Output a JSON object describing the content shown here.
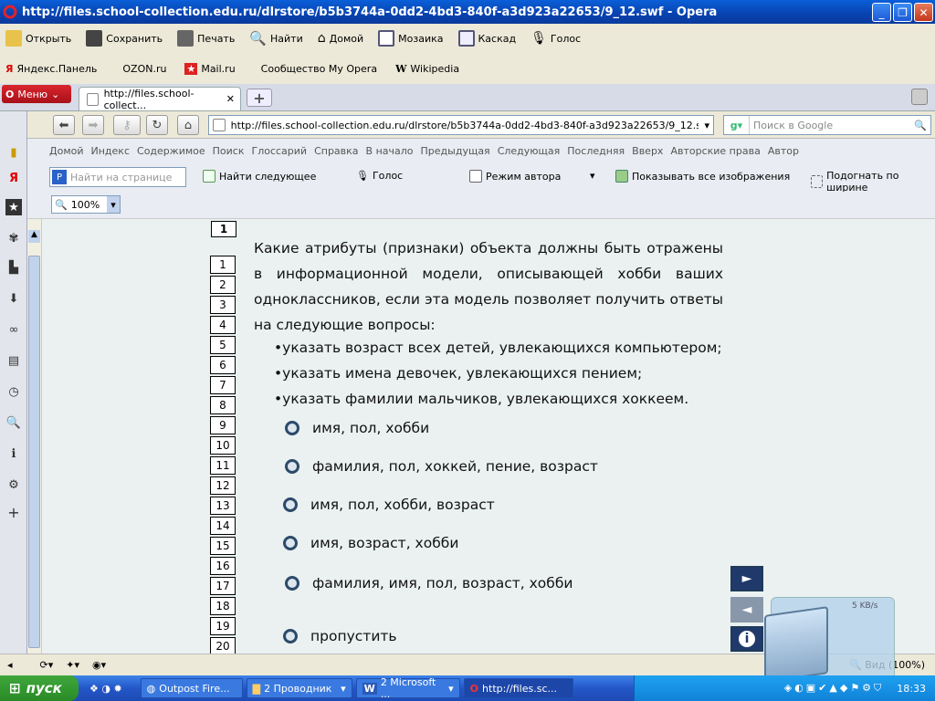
{
  "window": {
    "title": "http://files.school-collection.edu.ru/dlrstore/b5b3744a-0dd2-4bd3-840f-a3d923a22653/9_12.swf - Opera"
  },
  "toolbar_main": [
    {
      "label": "Открыть",
      "icon": "folder-open-icon"
    },
    {
      "label": "Сохранить",
      "icon": "save-icon"
    },
    {
      "label": "Печать",
      "icon": "printer-icon"
    },
    {
      "label": "Найти",
      "icon": "search-icon"
    },
    {
      "label": "Домой",
      "icon": "home-icon"
    },
    {
      "label": "Мозаика",
      "icon": "tile-icon"
    },
    {
      "label": "Каскад",
      "icon": "cascade-icon"
    },
    {
      "label": "Голос",
      "icon": "microphone-icon"
    }
  ],
  "bookmarks": [
    {
      "label": "Яндекс.Панель"
    },
    {
      "label": "OZON.ru"
    },
    {
      "label": "Mail.ru"
    },
    {
      "label": "Сообщество My Opera"
    },
    {
      "label": "Wikipedia"
    }
  ],
  "menu_button": "Меню",
  "tab": {
    "title": "http://files.school-collect..."
  },
  "address": {
    "url": "http://files.school-collection.edu.ru/dlrstore/b5b3744a-0dd2-4bd3-840f-a3d923a22653/9_12.swf",
    "search_placeholder": "Поиск в Google"
  },
  "nav_links": [
    "Домой",
    "Индекс",
    "Содержимое",
    "Поиск",
    "Глоссарий",
    "Справка",
    "В начало",
    "Предыдущая",
    "Следующая",
    "Последняя",
    "Вверх",
    "Авторские права",
    "Автор"
  ],
  "findbar": {
    "placeholder": "Найти на странице",
    "find_next": "Найти следующее",
    "voice": "Голос",
    "author_mode": "Режим автора",
    "show_images": "Показывать все изображения",
    "fit_width": "Подогнать по ширине"
  },
  "zoom": {
    "value": "100%"
  },
  "lesson": {
    "current": "1",
    "numbers": [
      "1",
      "2",
      "3",
      "4",
      "5",
      "6",
      "7",
      "8",
      "9",
      "10",
      "11",
      "12",
      "13",
      "14",
      "15",
      "16",
      "17",
      "18",
      "19",
      "20"
    ],
    "question": "Какие атрибуты (признаки) объекта должны быть отражены в информационной модели, описывающей хобби ваших одноклассников, если эта модель позволяет получить ответы на следующие вопросы:",
    "bullets": [
      "•указать возраст всех детей, увлекающихся компьютером;",
      "•указать имена девочек, увлекающихся пением;",
      "•указать фамилии мальчиков, увлекающихся хоккеем."
    ],
    "options": [
      "имя, пол, хобби",
      "фамилия, пол, хоккей, пение, возраст",
      "имя, пол, хобби, возраст",
      "имя, возраст, хобби",
      "фамилия, имя, пол, возраст, хобби"
    ],
    "skip": "пропустить"
  },
  "statusbar": {
    "view": "Вид (100%)"
  },
  "gadget": {
    "speed": "5 KB/s"
  },
  "taskbar": {
    "start": "пуск",
    "items": [
      {
        "label": "Outpost Fire..."
      },
      {
        "label": "2 Проводник"
      },
      {
        "label": "2 Microsoft ..."
      },
      {
        "label": "http://files.sc..."
      }
    ],
    "clock": "18:33"
  },
  "colors": {
    "content_bg": "#eaf1f0",
    "radio": "#2c4a6a",
    "title_blue": "#0a5fd8"
  }
}
